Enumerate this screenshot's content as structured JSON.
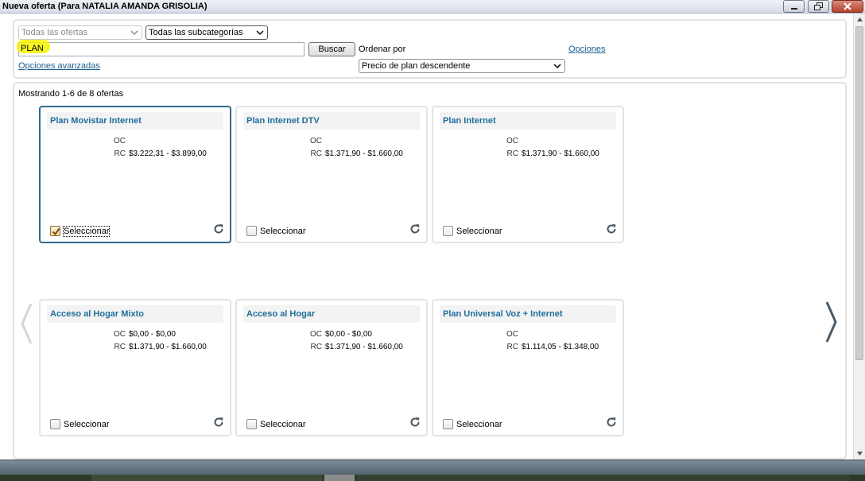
{
  "window": {
    "title": "Nueva oferta (Para NATALIA AMANDA GRISOLIA)"
  },
  "search": {
    "offers_filter": "Todas las ofertas",
    "subcategory_filter": "Todas las subcategorías",
    "query": "PLAN",
    "search_button": "Buscar",
    "sort_label": "Ordenar por",
    "sort_value": "Precio de plan descendente",
    "options_link": "Opciones",
    "advanced_link": "Opciones avanzadas"
  },
  "results": {
    "summary": "Mostrando 1-6 de 8 ofertas",
    "select_label": "Seleccionar",
    "oc_label": "OC",
    "rc_label": "RC",
    "cards": [
      {
        "title": "Plan Movistar Internet",
        "oc": "",
        "rc": "$3.222,31 - $3.899,00",
        "selected": true
      },
      {
        "title": "Plan Internet DTV",
        "oc": "",
        "rc": "$1.371,90 - $1.660,00",
        "selected": false
      },
      {
        "title": "Plan Internet",
        "oc": "",
        "rc": "$1.371,90 - $1.660,00",
        "selected": false
      },
      {
        "title": "Acceso al Hogar Mixto",
        "oc": "$0,00 - $0,00",
        "rc": "$1.371,90 - $1.660,00",
        "selected": false
      },
      {
        "title": "Acceso al Hogar",
        "oc": "$0,00 - $0,00",
        "rc": "$1.371,90 - $1.660,00",
        "selected": false
      },
      {
        "title": "Plan Universal Voz + Internet",
        "oc": "",
        "rc": "$1.114,05 - $1.348,00",
        "selected": false
      }
    ]
  },
  "icons": {
    "refresh": "refresh-icon",
    "prev": "chevron-left-icon",
    "next": "chevron-right-icon"
  },
  "colors": {
    "accent": "#1f6e9c",
    "selected_border": "#2f6d91",
    "highlight": "#f7f500"
  }
}
